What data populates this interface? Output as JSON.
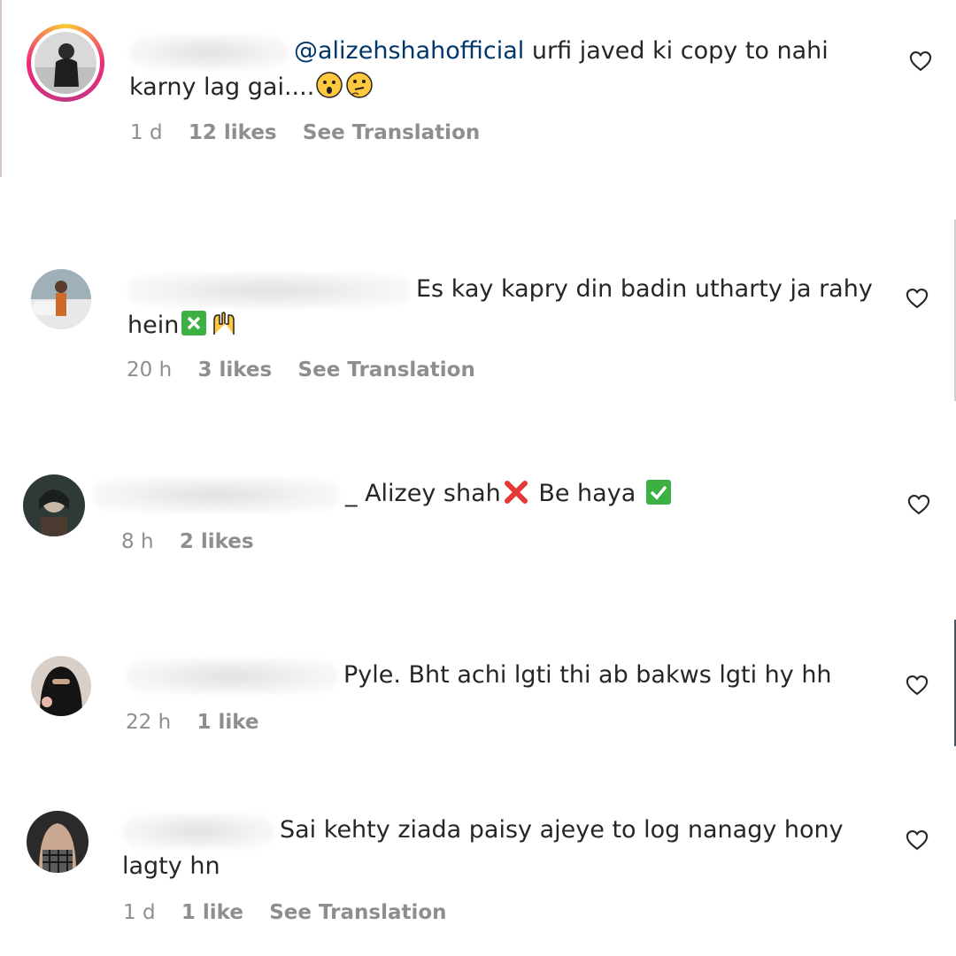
{
  "comments": [
    {
      "mention": "@alizehshahofficial",
      "text_line1": "urfi javed ki copy to nahi",
      "text_line2": "karny lag gai....",
      "emojis": [
        "astonished-face-emoji",
        "thinking-face-emoji"
      ],
      "time": "1 d",
      "likes": "12 likes",
      "translation": "See Translation"
    },
    {
      "text_line1": "Es kay kapry din badin utharty ja rahy",
      "text_line2": "hein",
      "emojis": [
        "cross-mark-button-emoji",
        "raising-hands-emoji"
      ],
      "time": "20 h",
      "likes": "3 likes",
      "translation": "See Translation"
    },
    {
      "text_prefix": "_ Alizey shah",
      "text_middle": "Be haya",
      "emojis": [
        "cross-mark-emoji",
        "check-mark-button-emoji"
      ],
      "time": "8 h",
      "likes": "2 likes"
    },
    {
      "text_line1": "Pyle. Bht achi lgti thi ab bakws lgti hy hh",
      "time": "22 h",
      "likes": "1 like"
    },
    {
      "text_line1": "Sai kehty ziada paisy ajeye to log nanagy hony",
      "text_line2": "lagty hn",
      "time": "1 d",
      "likes": "1 like",
      "translation": "See Translation"
    }
  ],
  "icons": {
    "like": "heart-outline-icon"
  },
  "colors": {
    "text": "#262626",
    "secondary": "#8e8e8e",
    "mention": "#00376b"
  }
}
